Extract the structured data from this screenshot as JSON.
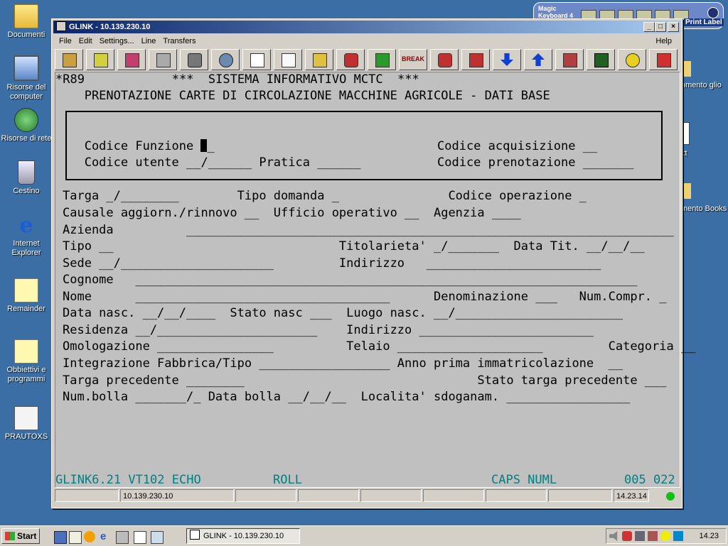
{
  "desktop": {
    "icons": [
      {
        "label": "Documenti",
        "icon": "folder-icon"
      },
      {
        "label": "Risorse del computer",
        "icon": "computer-icon"
      },
      {
        "label": "Risorse di rete",
        "icon": "network-icon"
      },
      {
        "label": "Cestino",
        "icon": "recycle-bin-icon"
      },
      {
        "label": "Internet Explorer",
        "icon": "ie-icon"
      },
      {
        "label": "Remainder",
        "icon": "shortcut-icon"
      },
      {
        "label": "Obbiettivi e programmi",
        "icon": "shortcut-icon"
      },
      {
        "label": "PRAUTOXS",
        "icon": "app-icon"
      }
    ],
    "partial_right": [
      "nmento glio",
      "xt",
      "mento Books"
    ]
  },
  "magic_keyboard": {
    "label": "Magic Keyboard 4",
    "print_label": "Print Label"
  },
  "window": {
    "title": "GLINK - 10.139.230.10",
    "menu": [
      "File",
      "Edit",
      "Settings...",
      "Line",
      "Transfers"
    ],
    "help": "Help",
    "toolbar_break": "BREAK"
  },
  "terminal": {
    "lines": [
      "*R89            ***  SISTEMA INFORMATIVO MCTC  ***",
      "   PRENOTAZIONE CARTE DI CIRCOLAZIONE MACCHINE AGRICOLE - DATI BASE",
      "   Codice Funzione ",
      "   Codice utente __/______ Pratica ______",
      "Targa _/________        Tipo domanda _               Codice operazione _",
      "Causale aggiorn./rinnovo __  Ufficio operativo __  Agenzia ____",
      "Azienda          ___________________________________________________________________",
      "Tipo __                               Titolarieta' _/_______  Data Tit. __/__/__",
      "Sede __/_____________________         Indirizzo   ________________________",
      "Cognome   _____________________________________________________________________",
      "Nome      ___________________________________      Denominazione ___   Num.Compr. _",
      "Data nasc. __/__/____  Stato nasc ___  Luogo nasc. __/_______________________",
      "Residenza __/______________________    Indirizzo ________________________",
      "Omologazione ________________          Telaio ____________________         Categoria __",
      "Integrazione Fabbrica/Tipo __________________ Anno prima immatricolazione  __",
      "Targa precedente ________                                Stato targa precedente ___",
      "Num.bolla _______/_ Data bolla __/__/__  Localita' sdoganam. _________________"
    ],
    "cursor_trail": "_",
    "right_line3": "Codice acquisizione __",
    "right_line4": "Codice prenotazione _______",
    "status_left": "GLINK6.21 VT102 ECHO",
    "status_roll": "ROLL",
    "status_caps": "CAPS NUML",
    "status_pos": "005 022"
  },
  "statusbar": {
    "host": "10.139.230.10",
    "time": "14.23.14"
  },
  "taskbar": {
    "start": "Start",
    "task": "GLINK - 10.139.230.10",
    "clock": "14.23"
  }
}
